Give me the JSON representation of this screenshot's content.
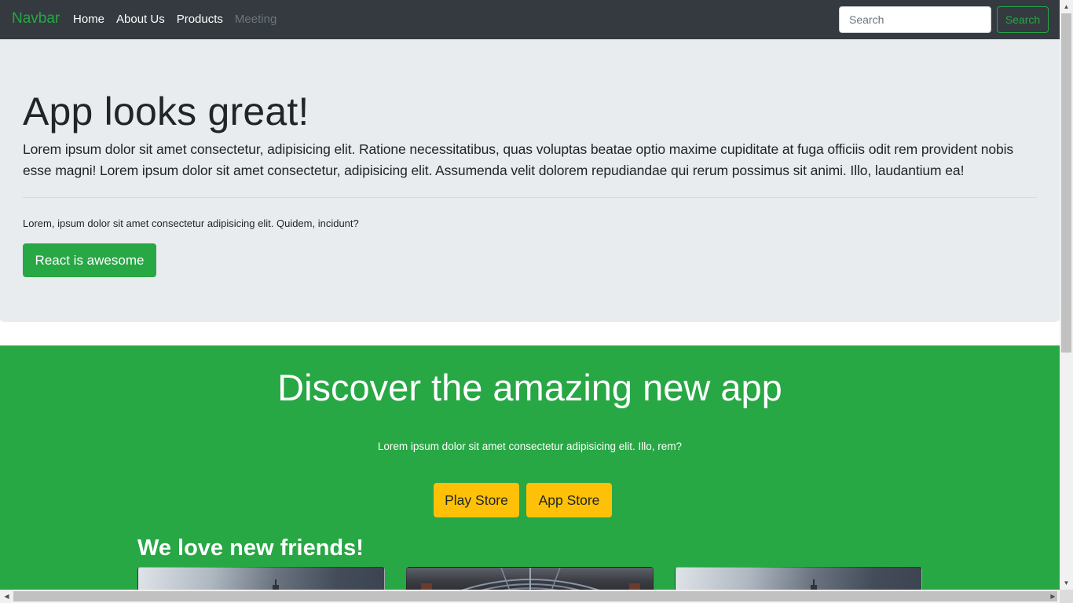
{
  "navbar": {
    "brand": "Navbar",
    "links": [
      {
        "label": "Home"
      },
      {
        "label": "About Us"
      },
      {
        "label": "Products"
      },
      {
        "label": "Meeting"
      }
    ],
    "search": {
      "placeholder": "Search",
      "button_label": "Search"
    }
  },
  "jumbotron": {
    "title": "App looks great!",
    "lead": "Lorem ipsum dolor sit amet consectetur, adipisicing elit. Ratione necessitatibus, quas voluptas beatae optio maxime cupiditate at fuga officiis odit rem provident nobis esse magni! Lorem ipsum dolor sit amet consectetur, adipisicing elit. Assumenda velit dolorem repudiandae qui rerum possimus sit animi. Illo, laudantium ea!",
    "text": "Lorem, ipsum dolor sit amet consectetur adipisicing elit. Quidem, incidunt?",
    "button_label": "React is awesome"
  },
  "promo": {
    "title": "Discover the amazing new app",
    "subtitle": "Lorem ipsum dolor sit amet consectetur adipisicing elit. Illo, rem?",
    "buttons": [
      {
        "label": "Play Store"
      },
      {
        "label": "App Store"
      }
    ],
    "friends_title": "We love new friends!"
  },
  "colors": {
    "navbar_bg": "#343a40",
    "brand": "#28a745",
    "jumbotron_bg": "#e9ecef",
    "success": "#28a745",
    "warning": "#ffc107"
  },
  "icons": {
    "scroll_up": "▲",
    "scroll_down": "▼",
    "scroll_left": "◀",
    "scroll_right": "▶"
  }
}
